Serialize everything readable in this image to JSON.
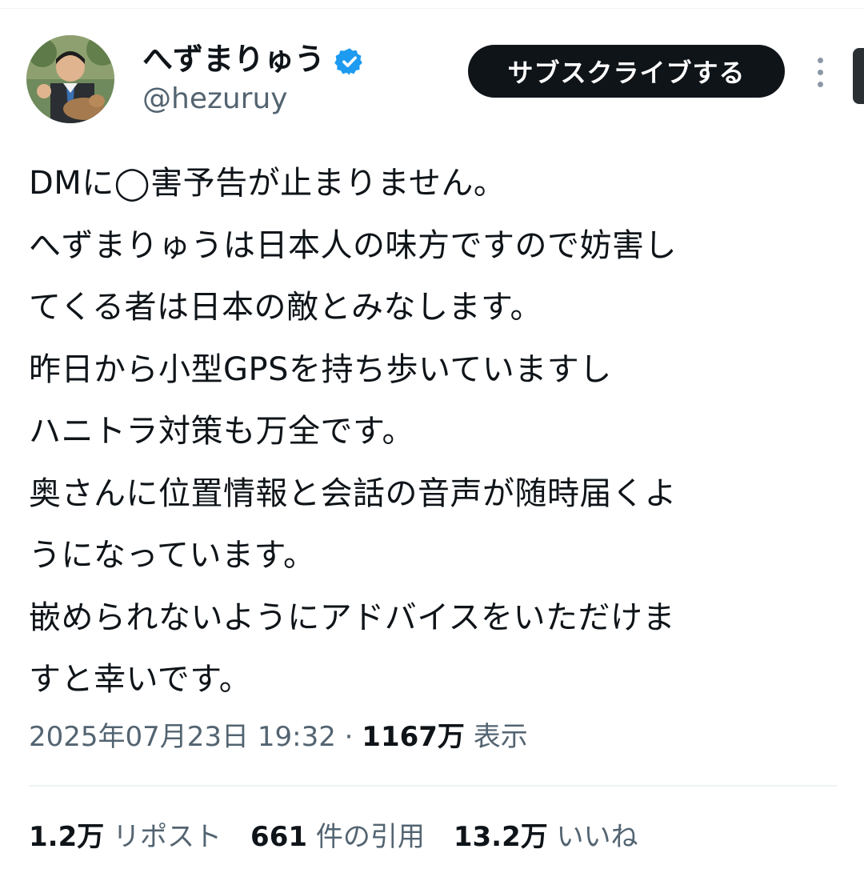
{
  "author": {
    "display_name": "へずまりゅう",
    "handle": "@hezuruy",
    "verified_icon": "verified-badge-icon",
    "avatar_icon": "avatar"
  },
  "actions": {
    "subscribe_label": "サブスクライブする",
    "more_icon": "more-vertical-icon"
  },
  "tweet": {
    "lines": [
      "DMに◯害予告が止まりません。",
      "へずまりゅうは日本人の味方ですので妨害し",
      "てくる者は日本の敵とみなします。",
      "昨日から小型GPSを持ち歩いていますし",
      "ハニトラ対策も万全です。",
      "奥さんに位置情報と会話の音声が随時届くよ",
      "うになっています。",
      "嵌められないようにアドバイスをいただけま",
      "すと幸いです。"
    ]
  },
  "meta": {
    "timestamp": "2025年07月23日 19:32",
    "separator": " · ",
    "views_count": "1167万",
    "views_label": " 表示"
  },
  "stats": {
    "reposts_count": "1.2万",
    "reposts_label": " リポスト",
    "quotes_count": "661",
    "quotes_label": " 件の引用",
    "likes_count": "13.2万",
    "likes_label": " いいね"
  },
  "colors": {
    "text_primary": "#0f1419",
    "text_secondary": "#536471",
    "verified_blue": "#1d9bf0",
    "button_bg": "#0f1419",
    "divider": "#eff3f4"
  }
}
